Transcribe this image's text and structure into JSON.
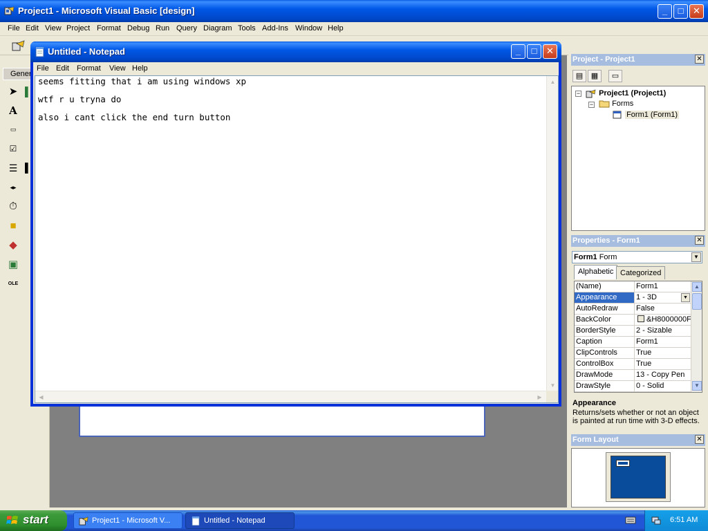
{
  "vb": {
    "title": "Project1 - Microsoft Visual Basic [design]",
    "menu": [
      "File",
      "Edit",
      "View",
      "Project",
      "Format",
      "Debug",
      "Run",
      "Query",
      "Diagram",
      "Tools",
      "Add-Ins",
      "Window",
      "Help"
    ],
    "toolbox_tab": "General"
  },
  "notepad": {
    "title": "Untitled - Notepad",
    "menu": [
      "File",
      "Edit",
      "Format",
      "View",
      "Help"
    ],
    "lines": [
      "seems fitting that i am using windows xp",
      "wtf r u tryna do",
      "also i cant click the end turn button"
    ]
  },
  "project": {
    "title": "Project - Project1",
    "root": "Project1 (Project1)",
    "folder": "Forms",
    "item": "Form1 (Form1)"
  },
  "properties": {
    "title": "Properties - Form1",
    "object_name": "Form1",
    "object_type": "Form",
    "tabs": [
      "Alphabetic",
      "Categorized"
    ],
    "rows": [
      {
        "k": "(Name)",
        "v": "Form1"
      },
      {
        "k": "Appearance",
        "v": "1 - 3D"
      },
      {
        "k": "AutoRedraw",
        "v": "False"
      },
      {
        "k": "BackColor",
        "v": "&H8000000F"
      },
      {
        "k": "BorderStyle",
        "v": "2 - Sizable"
      },
      {
        "k": "Caption",
        "v": "Form1"
      },
      {
        "k": "ClipControls",
        "v": "True"
      },
      {
        "k": "ControlBox",
        "v": "True"
      },
      {
        "k": "DrawMode",
        "v": "13 - Copy Pen"
      },
      {
        "k": "DrawStyle",
        "v": "0 - Solid"
      }
    ],
    "desc_title": "Appearance",
    "desc_text": "Returns/sets whether or not an object is painted at run time with 3-D effects."
  },
  "form_layout": {
    "title": "Form Layout"
  },
  "taskbar": {
    "start": "start",
    "tasks": [
      "Project1 - Microsoft V...",
      "Untitled - Notepad"
    ],
    "clock": "6:51 AM"
  },
  "colors": {
    "xp_blue": "#0058e6",
    "start_green": "#3c9a3a",
    "selection": "#316ac5"
  }
}
